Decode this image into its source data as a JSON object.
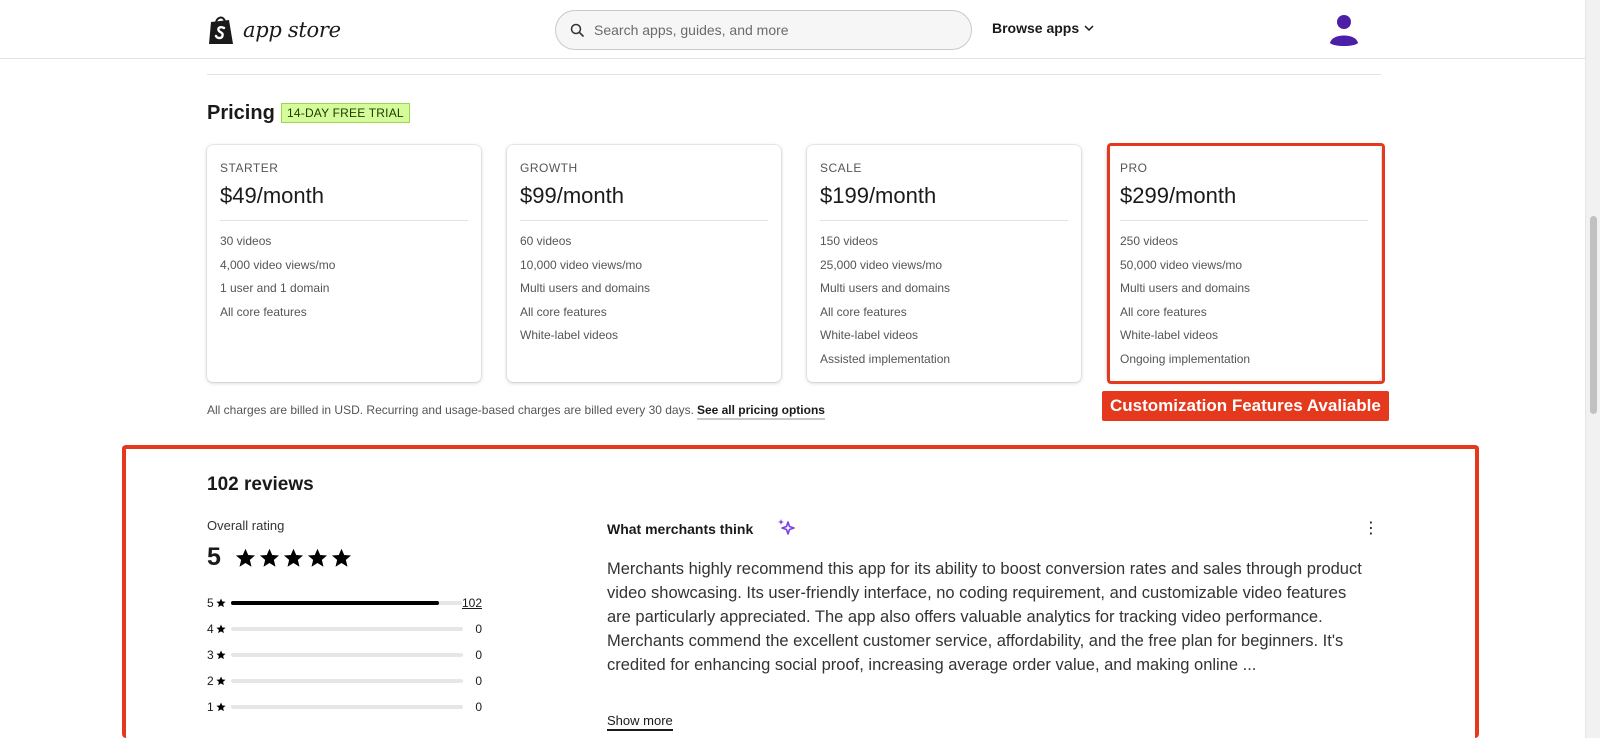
{
  "header": {
    "logo_text": "app store",
    "search_placeholder": "Search apps, guides, and more",
    "browse_label": "Browse apps"
  },
  "colors": {
    "accent_red": "#e5391e",
    "trial_badge_bg": "#d5fb9a",
    "avatar_purple": "#4b1fa8"
  },
  "pricing": {
    "title": "Pricing",
    "trial_badge": "14-DAY FREE TRIAL",
    "plans": [
      {
        "name": "STARTER",
        "price": "$49/month",
        "features": [
          "30 videos",
          "4,000 video views/mo",
          "1 user and 1 domain",
          "All core features"
        ]
      },
      {
        "name": "GROWTH",
        "price": "$99/month",
        "features": [
          "60 videos",
          "10,000 video views/mo",
          "Multi users and domains",
          "All core features",
          "White-label videos"
        ]
      },
      {
        "name": "SCALE",
        "price": "$199/month",
        "features": [
          "150 videos",
          "25,000 video views/mo",
          "Multi users and domains",
          "All core features",
          "White-label videos",
          "Assisted implementation"
        ]
      },
      {
        "name": "PRO",
        "price": "$299/month",
        "features": [
          "250 videos",
          "50,000 video views/mo",
          "Multi users and domains",
          "All core features",
          "White-label videos",
          "Ongoing implementation"
        ]
      }
    ],
    "callout": "Customization Features Avaliable",
    "billing_note": "All charges are billed in USD. Recurring and usage-based charges are billed every 30 days.",
    "see_all_link": "See all pricing options"
  },
  "reviews": {
    "title": "102 reviews",
    "overall_label": "Overall rating",
    "overall_value": "5",
    "distribution": [
      {
        "stars": "5",
        "count": "102",
        "fraction": 1.0
      },
      {
        "stars": "4",
        "count": "0",
        "fraction": 0
      },
      {
        "stars": "3",
        "count": "0",
        "fraction": 0
      },
      {
        "stars": "2",
        "count": "0",
        "fraction": 0
      },
      {
        "stars": "1",
        "count": "0",
        "fraction": 0
      }
    ],
    "merchants_title": "What merchants think",
    "summary": "Merchants highly recommend this app for its ability to boost conversion rates and sales through product video showcasing. Its user-friendly interface, no coding requirement, and customizable video features are particularly appreciated. The app also offers valuable analytics for tracking video performance. Merchants commend the excellent customer service, affordability, and the free plan for beginners. It's credited for enhancing social proof, increasing average order value, and making online ...",
    "show_more": "Show more"
  }
}
